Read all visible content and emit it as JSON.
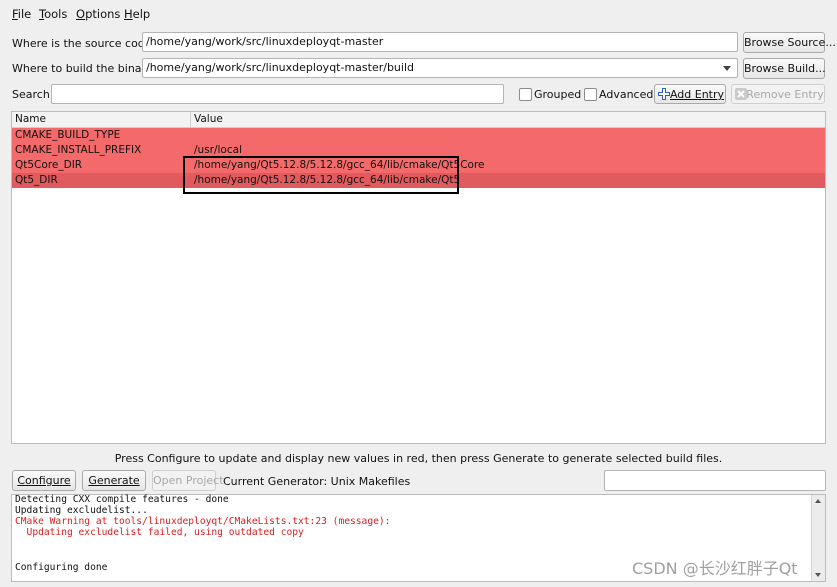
{
  "menu": [
    "File",
    "Tools",
    "Options",
    "Help"
  ],
  "source": {
    "label": "Where is the source code:",
    "value": "/home/yang/work/src/linuxdeployqt-master",
    "button": "Browse Source..."
  },
  "build": {
    "label": "Where to build the binaries:",
    "value": "/home/yang/work/src/linuxdeployqt-master/build",
    "button": "Browse Build..."
  },
  "search": {
    "label": "Search:",
    "value": "",
    "grouped_label": "Grouped",
    "advanced_label": "Advanced",
    "add_entry": "Add Entry",
    "remove_entry": "Remove Entry"
  },
  "table": {
    "columns": [
      "Name",
      "Value"
    ],
    "rows": [
      {
        "name": "CMAKE_BUILD_TYPE",
        "value": ""
      },
      {
        "name": "CMAKE_INSTALL_PREFIX",
        "value": "/usr/local"
      },
      {
        "name": "Qt5Core_DIR",
        "value": "/home/yang/Qt5.12.8/5.12.8/gcc_64/lib/cmake/Qt5Core"
      },
      {
        "name": "Qt5_DIR",
        "value": "/home/yang/Qt5.12.8/5.12.8/gcc_64/lib/cmake/Qt5"
      }
    ]
  },
  "hint": "Press Configure to update and display new values in red, then press Generate to generate selected build files.",
  "actions": {
    "configure": "Configure",
    "generate": "Generate",
    "open_project": "Open Project",
    "generator": "Current Generator: Unix Makefiles"
  },
  "log": [
    {
      "text": "Detecting CXX compile features - done",
      "level": "info"
    },
    {
      "text": "Updating excludelist...",
      "level": "info"
    },
    {
      "text": "CMake Warning at tools/linuxdeployqt/CMakeLists.txt:23 (message):",
      "level": "warn"
    },
    {
      "text": "  Updating excludelist failed, using outdated copy",
      "level": "warn"
    },
    {
      "text": "",
      "level": "info"
    },
    {
      "text": "Configuring done",
      "level": "info"
    }
  ],
  "watermark": "CSDN @长沙红胖子Qt",
  "colors": {
    "changed_row": "#f46a6a",
    "selected_row": "#e05a5e",
    "warning_text": "#d82020",
    "add_icon": "#2a5fc0"
  }
}
